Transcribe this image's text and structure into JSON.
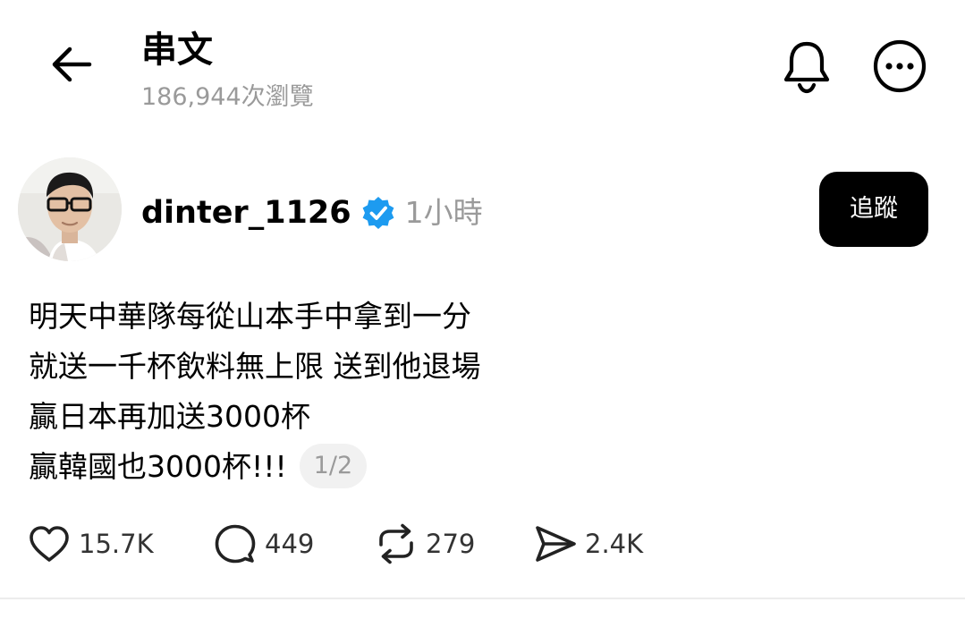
{
  "header": {
    "title": "串文",
    "views": "186,944次瀏覽"
  },
  "post": {
    "author": {
      "username": "dinter_1126",
      "timestamp": "1小時"
    },
    "follow_label": "追蹤",
    "lines": [
      "明天中華隊每從山本手中拿到一分",
      "就送一千杯飲料無上限 送到他退場",
      "贏日本再加送3000杯",
      "贏韓國也3000杯!!!"
    ],
    "page_indicator": "1/2",
    "actions": {
      "likes": "15.7K",
      "comments": "449",
      "reposts": "279",
      "shares": "2.4K"
    }
  },
  "colors": {
    "text": "#000000",
    "muted": "#9a9a9a",
    "verified": "#1d9bf0",
    "follow_bg": "#000000",
    "badge_bg": "#f1f1f1"
  },
  "icons": [
    "back-arrow-icon",
    "bell-icon",
    "more-icon",
    "verified-icon",
    "heart-icon",
    "comment-icon",
    "repost-icon",
    "share-icon"
  ]
}
